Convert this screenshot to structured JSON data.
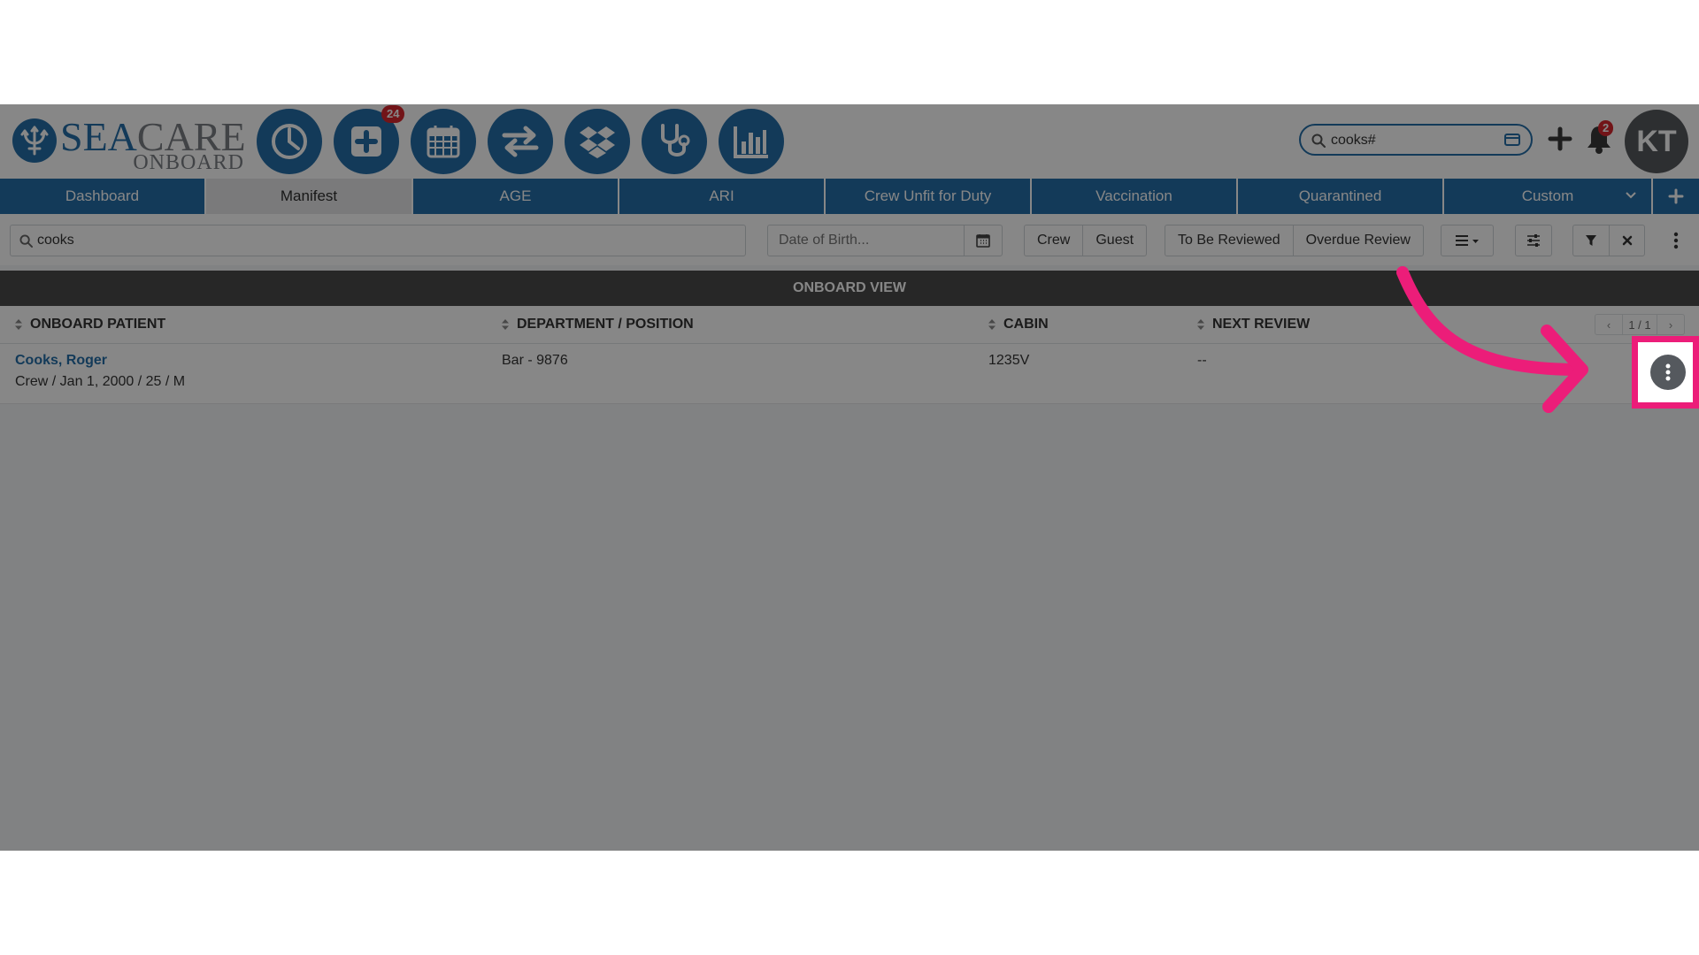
{
  "header": {
    "logo": {
      "sea": "SEA",
      "care": "CARE",
      "onboard": "ONBOARD"
    },
    "nav_icons": [
      {
        "name": "dashboard-pie-icon"
      },
      {
        "name": "add-medical-icon",
        "badge": "24"
      },
      {
        "name": "calendar-icon"
      },
      {
        "name": "transfer-arrows-icon"
      },
      {
        "name": "dropbox-icon"
      },
      {
        "name": "stethoscope-icon"
      },
      {
        "name": "bar-chart-icon"
      }
    ],
    "search": {
      "value": "cooks#"
    },
    "notifications_count": "2",
    "avatar_initials": "KT"
  },
  "tabs": [
    {
      "label": "Dashboard",
      "active": false
    },
    {
      "label": "Manifest",
      "active": true
    },
    {
      "label": "AGE",
      "active": false
    },
    {
      "label": "ARI",
      "active": false
    },
    {
      "label": "Crew Unfit for Duty",
      "active": false
    },
    {
      "label": "Vaccination",
      "active": false
    },
    {
      "label": "Quarantined",
      "active": false
    },
    {
      "label": "Custom",
      "active": false
    }
  ],
  "toolbar": {
    "search_value": "cooks",
    "dob_placeholder": "Date of Birth...",
    "type_buttons": [
      "Crew",
      "Guest"
    ],
    "review_buttons": [
      "To Be Reviewed",
      "Overdue Review"
    ]
  },
  "view_title": "ONBOARD VIEW",
  "table": {
    "columns": [
      "ONBOARD PATIENT",
      "DEPARTMENT / POSITION",
      "CABIN",
      "NEXT REVIEW"
    ],
    "pager": {
      "prev": "‹",
      "count": "1 / 1",
      "next": "›"
    },
    "rows": [
      {
        "name": "Cooks, Roger",
        "meta": "Crew / Jan 1, 2000 / 25 / M",
        "department": "Bar - 9876",
        "cabin": "1235V",
        "next_review": "--"
      }
    ]
  },
  "colors": {
    "brand_blue": "#256fa8",
    "highlight_pink": "#ec1d79",
    "badge_red": "#d7262e"
  }
}
